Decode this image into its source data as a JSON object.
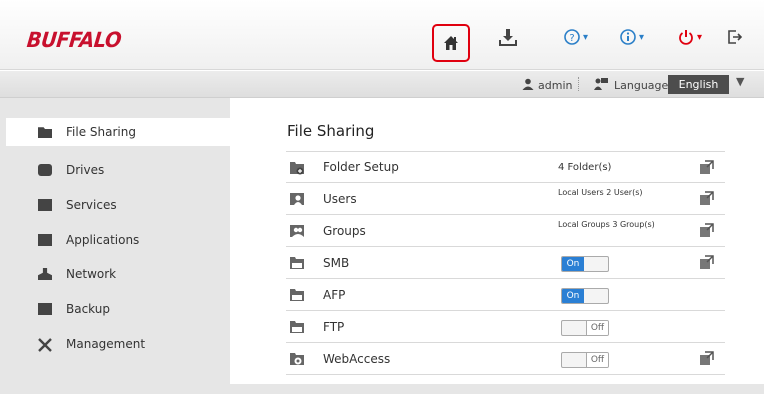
{
  "header": {
    "logo": "BUFFALO",
    "buttons": [
      {
        "name": "home-icon"
      },
      {
        "name": "download-icon"
      },
      {
        "name": "help-icon",
        "caret": "▾"
      },
      {
        "name": "info-icon",
        "caret": "▾"
      },
      {
        "name": "power-icon",
        "caret": "▾"
      },
      {
        "name": "logout-icon"
      }
    ],
    "highlight_color": "#e0000f",
    "brand_color": "#c8102e"
  },
  "userbar": {
    "user": "admin",
    "language_label": "Language",
    "language_value": "English",
    "caret": "▼"
  },
  "sidebar": {
    "items": [
      {
        "label": "File Sharing",
        "icon": "folder-icon",
        "active": true
      },
      {
        "label": "Drives",
        "icon": "drive-icon"
      },
      {
        "label": "Services",
        "icon": "services-icon"
      },
      {
        "label": "Applications",
        "icon": "applications-icon"
      },
      {
        "label": "Network",
        "icon": "network-icon"
      },
      {
        "label": "Backup",
        "icon": "backup-icon"
      },
      {
        "label": "Management",
        "icon": "management-icon"
      }
    ]
  },
  "main": {
    "title": "File Sharing",
    "rows": [
      {
        "label": "Folder Setup",
        "value": "4 Folder(s)",
        "editable": true
      },
      {
        "label": "Users",
        "value": "Local Users 2 User(s)",
        "editable": true
      },
      {
        "label": "Groups",
        "value": "Local Groups 3 Group(s)",
        "editable": true
      },
      {
        "label": "SMB",
        "toggle": "On",
        "editable": true
      },
      {
        "label": "AFP",
        "toggle": "On",
        "editable": false
      },
      {
        "label": "FTP",
        "toggle": "Off",
        "editable": false
      },
      {
        "label": "WebAccess",
        "toggle": "Off",
        "editable": true
      }
    ],
    "toggle_on_color": "#2a7fd4"
  }
}
